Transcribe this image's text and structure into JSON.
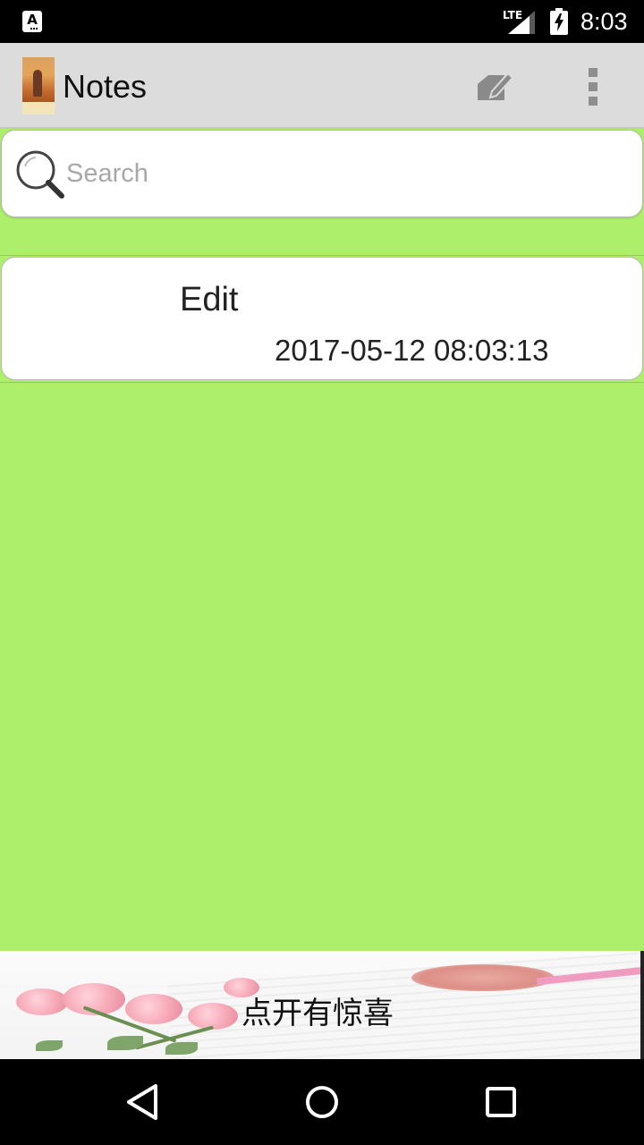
{
  "status_bar": {
    "app_icon_letter": "A",
    "network_label": "LTE",
    "time": "8:03"
  },
  "app_bar": {
    "title": "Notes",
    "compose_icon": "compose-note-icon",
    "overflow_icon": "more-vert-icon"
  },
  "search": {
    "placeholder": "Search",
    "icon": "search-icon"
  },
  "notes": [
    {
      "title": "Edit",
      "timestamp": "2017-05-12 08:03:13"
    }
  ],
  "ad_banner": {
    "text": "点开有惊喜"
  },
  "nav_bar": {
    "back_icon": "back-triangle-icon",
    "home_icon": "home-circle-icon",
    "recents_icon": "recents-square-icon"
  },
  "colors": {
    "background": "#adee6a",
    "app_bar": "#dcdcdc",
    "card": "#ffffff"
  }
}
